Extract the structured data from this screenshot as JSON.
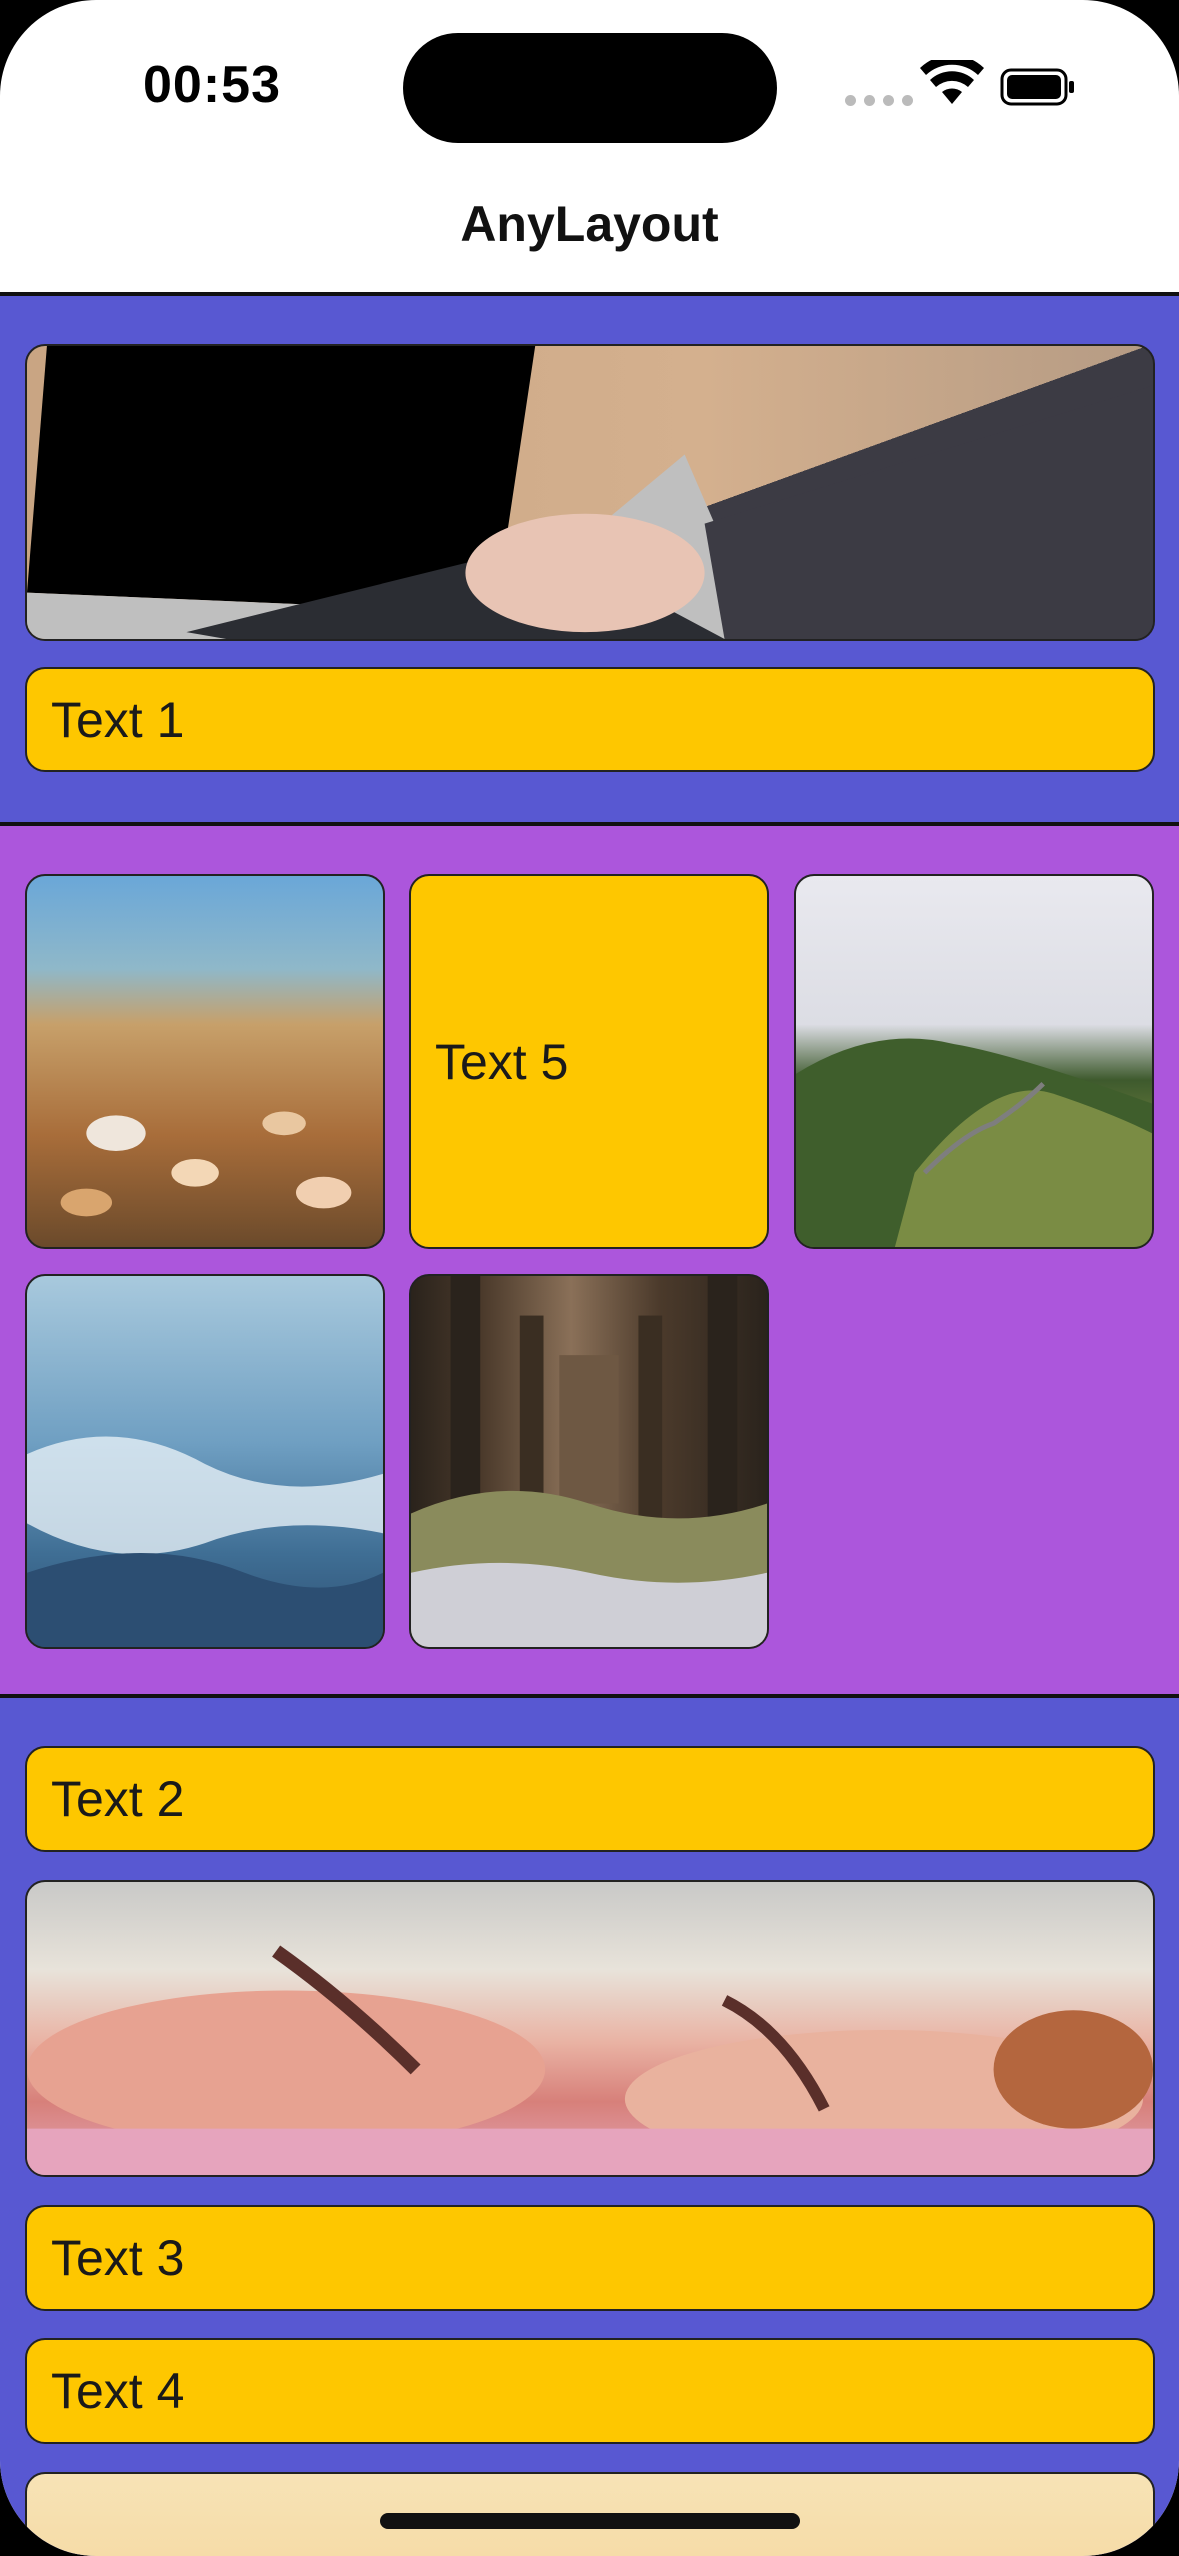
{
  "status": {
    "time": "00:53"
  },
  "nav": {
    "title": "AnyLayout"
  },
  "section_a": {
    "image": "laptop-photo",
    "text": "Text 1"
  },
  "section_b": {
    "images": [
      "beach-shells-photo",
      "hill-road-photo",
      "mountains-sky-photo",
      "pier-waves-photo"
    ],
    "text": "Text 5"
  },
  "section_c": {
    "texts": [
      "Text 2",
      "Text 3",
      "Text 4"
    ],
    "image": "sunbathing-photo"
  },
  "colors": {
    "section_blue": "#5858d2",
    "section_purple": "#ac56dc",
    "text_card": "#fec700"
  }
}
